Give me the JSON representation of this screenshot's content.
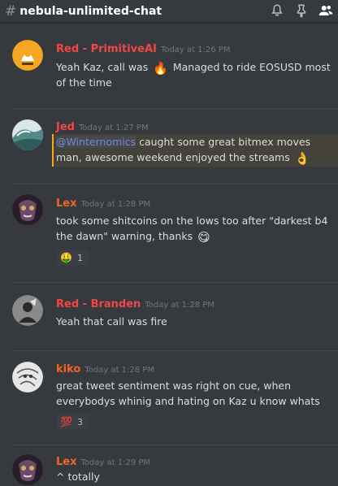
{
  "header": {
    "hash": "#",
    "channel": "nebula-unlimited-chat",
    "icons": [
      "bell-icon",
      "pin-icon",
      "members-icon"
    ]
  },
  "colors": {
    "background": "#36393e",
    "red_role": "#f04747",
    "lex_role": "#f26522",
    "mention": "#7289da",
    "mention_border": "#faa61a",
    "timestamp": "#72767d"
  },
  "messages": [
    {
      "author": "Red - PrimitiveAI",
      "author_color": "#f04747",
      "time": "Today at 1:26 PM",
      "line1": "Yeah Kaz, call was ",
      "emoji1": "🔥",
      "line1b": " Managed to ride EOSUSD most",
      "line2": "of the time"
    },
    {
      "author": "Jed",
      "author_color": "#f04747",
      "time": "Today at 1:27 PM",
      "mention": "@Winternomics",
      "line1": " caught some great bitmex moves",
      "line2": "man, awesome weekend enjoyed the streams ",
      "emoji1": "👌"
    },
    {
      "author": "Lex",
      "author_color": "#f26522",
      "time": "Today at 1:28 PM",
      "line1": "took some shitcoins on the lows too after \"darkest b4",
      "line2": "the dawn\" warning, thanks ",
      "emoji1": "😋",
      "reaction_emoji": "🤑",
      "reaction_count": "1"
    },
    {
      "author": "Red - Branden",
      "author_color": "#f04747",
      "time": "Today at 1:28 PM",
      "line1": "Yeah that call was fire"
    },
    {
      "author": "kiko",
      "author_color": "#f26522",
      "time": "Today at 1:28 PM",
      "line1": "great tweet sentiment was right on cue, when",
      "line2": "everybodys whinig and hating on Kaz u know whats up",
      "reaction_emoji": "💯",
      "reaction_count": "3"
    },
    {
      "author": "Lex",
      "author_color": "#f26522",
      "time": "Today at 1:29 PM",
      "line1": "^ totally"
    }
  ]
}
